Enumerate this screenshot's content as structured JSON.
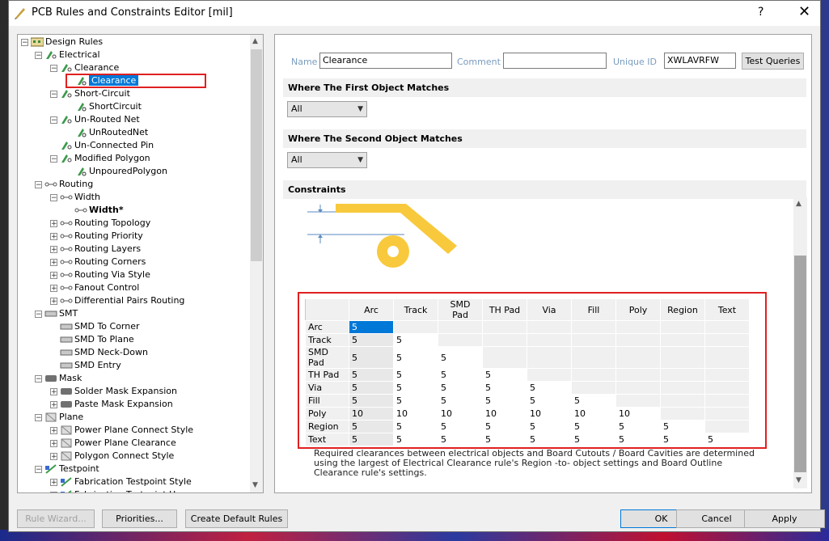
{
  "window": {
    "title": "PCB Rules and Constraints Editor [mil]",
    "help": "?",
    "close": "✕"
  },
  "tree": {
    "items": [
      {
        "label": "Design Rules",
        "level": 0,
        "exp": "−",
        "icon": "rules"
      },
      {
        "label": "Electrical",
        "level": 1,
        "exp": "−",
        "icon": "elec"
      },
      {
        "label": "Clearance",
        "level": 2,
        "exp": "−",
        "icon": "elec"
      },
      {
        "label": "Clearance",
        "level": 3,
        "exp": "",
        "icon": "rule",
        "selected": true
      },
      {
        "label": "Short-Circuit",
        "level": 2,
        "exp": "−",
        "icon": "elec"
      },
      {
        "label": "ShortCircuit",
        "level": 3,
        "exp": "",
        "icon": "rule"
      },
      {
        "label": "Un-Routed Net",
        "level": 2,
        "exp": "−",
        "icon": "elec"
      },
      {
        "label": "UnRoutedNet",
        "level": 3,
        "exp": "",
        "icon": "rule"
      },
      {
        "label": "Un-Connected Pin",
        "level": 2,
        "exp": "",
        "icon": "elec"
      },
      {
        "label": "Modified Polygon",
        "level": 2,
        "exp": "−",
        "icon": "elec"
      },
      {
        "label": "UnpouredPolygon",
        "level": 3,
        "exp": "",
        "icon": "rule"
      },
      {
        "label": "Routing",
        "level": 1,
        "exp": "−",
        "icon": "route"
      },
      {
        "label": "Width",
        "level": 2,
        "exp": "−",
        "icon": "route"
      },
      {
        "label": "Width*",
        "level": 3,
        "exp": "",
        "icon": "route",
        "bold": true
      },
      {
        "label": "Routing Topology",
        "level": 2,
        "exp": "+",
        "icon": "route"
      },
      {
        "label": "Routing Priority",
        "level": 2,
        "exp": "+",
        "icon": "route"
      },
      {
        "label": "Routing Layers",
        "level": 2,
        "exp": "+",
        "icon": "route"
      },
      {
        "label": "Routing Corners",
        "level": 2,
        "exp": "+",
        "icon": "route"
      },
      {
        "label": "Routing Via Style",
        "level": 2,
        "exp": "+",
        "icon": "route"
      },
      {
        "label": "Fanout Control",
        "level": 2,
        "exp": "+",
        "icon": "route"
      },
      {
        "label": "Differential Pairs Routing",
        "level": 2,
        "exp": "+",
        "icon": "route"
      },
      {
        "label": "SMT",
        "level": 1,
        "exp": "−",
        "icon": "smt"
      },
      {
        "label": "SMD To Corner",
        "level": 2,
        "exp": "",
        "icon": "smt"
      },
      {
        "label": "SMD To Plane",
        "level": 2,
        "exp": "",
        "icon": "smt"
      },
      {
        "label": "SMD Neck-Down",
        "level": 2,
        "exp": "",
        "icon": "smt"
      },
      {
        "label": "SMD Entry",
        "level": 2,
        "exp": "",
        "icon": "smt"
      },
      {
        "label": "Mask",
        "level": 1,
        "exp": "−",
        "icon": "mask"
      },
      {
        "label": "Solder Mask Expansion",
        "level": 2,
        "exp": "+",
        "icon": "mask"
      },
      {
        "label": "Paste Mask Expansion",
        "level": 2,
        "exp": "+",
        "icon": "mask"
      },
      {
        "label": "Plane",
        "level": 1,
        "exp": "−",
        "icon": "plane"
      },
      {
        "label": "Power Plane Connect Style",
        "level": 2,
        "exp": "+",
        "icon": "plane"
      },
      {
        "label": "Power Plane Clearance",
        "level": 2,
        "exp": "+",
        "icon": "plane"
      },
      {
        "label": "Polygon Connect Style",
        "level": 2,
        "exp": "+",
        "icon": "plane"
      },
      {
        "label": "Testpoint",
        "level": 1,
        "exp": "−",
        "icon": "test"
      },
      {
        "label": "Fabrication Testpoint Style",
        "level": 2,
        "exp": "+",
        "icon": "test"
      },
      {
        "label": "Fabrication Testpoint Usage",
        "level": 2,
        "exp": "+",
        "icon": "test"
      }
    ]
  },
  "form": {
    "name_label": "Name",
    "name_value": "Clearance",
    "comment_label": "Comment",
    "comment_value": "",
    "uid_label": "Unique ID",
    "uid_value": "XWLAVRFW",
    "test_queries": "Test Queries"
  },
  "sections": {
    "first": "Where The First Object Matches",
    "second": "Where The Second Object Matches",
    "constraints": "Constraints"
  },
  "combo1": "All",
  "combo2": "All",
  "matrix": {
    "columns": [
      "Arc",
      "Track",
      "SMD Pad",
      "TH Pad",
      "Via",
      "Fill",
      "Poly",
      "Region",
      "Text"
    ],
    "rows": [
      {
        "name": "Arc",
        "values": [
          "5"
        ]
      },
      {
        "name": "Track",
        "values": [
          "5",
          "5"
        ]
      },
      {
        "name": "SMD Pad",
        "values": [
          "5",
          "5",
          "5"
        ]
      },
      {
        "name": "TH Pad",
        "values": [
          "5",
          "5",
          "5",
          "5"
        ]
      },
      {
        "name": "Via",
        "values": [
          "5",
          "5",
          "5",
          "5",
          "5"
        ]
      },
      {
        "name": "Fill",
        "values": [
          "5",
          "5",
          "5",
          "5",
          "5",
          "5"
        ]
      },
      {
        "name": "Poly",
        "values": [
          "10",
          "10",
          "10",
          "10",
          "10",
          "10",
          "10"
        ]
      },
      {
        "name": "Region",
        "values": [
          "5",
          "5",
          "5",
          "5",
          "5",
          "5",
          "5",
          "5"
        ]
      },
      {
        "name": "Text",
        "values": [
          "5",
          "5",
          "5",
          "5",
          "5",
          "5",
          "5",
          "5",
          "5"
        ]
      }
    ]
  },
  "note": "Required clearances between electrical objects and Board Cutouts / Board Cavities are determined using the largest of Electrical Clearance rule's Region -to- object settings and Board Outline Clearance rule's settings.",
  "buttons": {
    "rule_wizard": "Rule Wizard...",
    "priorities": "Priorities...",
    "create_default": "Create Default Rules",
    "ok": "OK",
    "cancel": "Cancel",
    "apply": "Apply"
  },
  "colors": {
    "accent": "#0078d7",
    "highlight": "#e02020",
    "drawing": "#f8c93c"
  }
}
